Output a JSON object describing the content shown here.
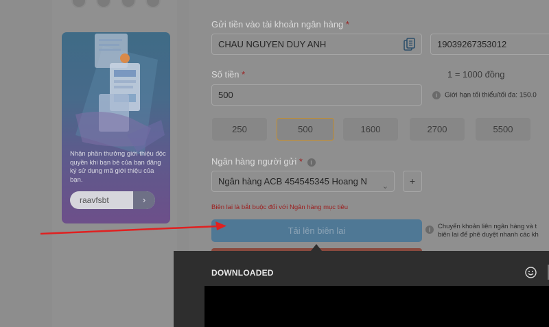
{
  "promo": {
    "text": "Nhận phần thưởng giới thiệu độc quyền khi bạn bè của bạn đăng ký sử dụng mã giới thiệu của bạn.",
    "referral_code": "raavfsbt",
    "go_icon": "chevron-right-icon"
  },
  "form": {
    "deposit_label": "Gửi tiền vào tài khoản ngân hàng",
    "account_name": "CHAU NGUYEN DUY ANH",
    "account_number": "19039267353012",
    "amount_label": "Số tiền",
    "rate_text": "1 = 1000 đồng",
    "amount_value": "500",
    "limit_hint": "Giới hạn tối thiểu/tối đa: 150.0",
    "amounts": [
      "250",
      "500",
      "1600",
      "2700",
      "5500"
    ],
    "selected_amount": "500",
    "sender_bank_label": "Ngân hàng người gửi",
    "sender_bank_value": "Ngân hàng ACB 454545345 Hoang N",
    "add_label": "+",
    "warning": "Biên lai là bắt buộc đối với Ngân hàng mục tiêu",
    "upload_label": "Tải lên biên lai",
    "upload_note_line1": "Chuyển khoản liên ngân hàng và t",
    "upload_note_line2": "biên lai để phê duyệt nhanh các kh",
    "required_mark": "*"
  },
  "overlay": {
    "title": "DOWNLOADED"
  },
  "colors": {
    "required": "#9c1d1d",
    "selected_border": "#c58e2e",
    "upload_button": "#4f7895",
    "annotation_arrow": "#e02020"
  }
}
